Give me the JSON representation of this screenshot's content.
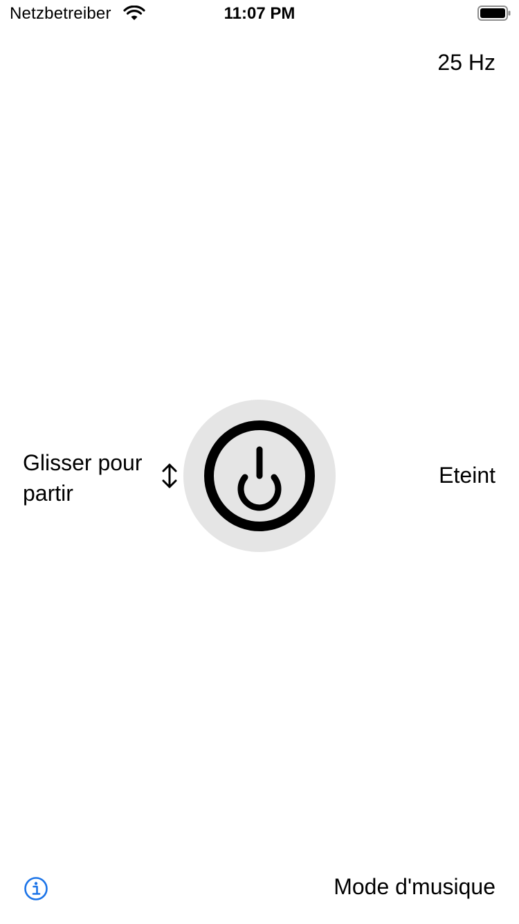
{
  "status_bar": {
    "carrier": "Netzbetreiber",
    "time": "11:07 PM",
    "wifi_icon": "wifi-icon",
    "battery_icon": "battery-full-icon"
  },
  "frequency": "25 Hz",
  "hint": "Glisser pour partir",
  "state": "Eteint",
  "power_icon": "power-icon",
  "swipe_icon": "up-down-arrow-icon",
  "info_icon": "info-icon",
  "mode_button": "Mode d'musique",
  "colors": {
    "background": "#ffffff",
    "text": "#000000",
    "power_circle": "#e5e5e5",
    "info_accent": "#1a73e8"
  }
}
